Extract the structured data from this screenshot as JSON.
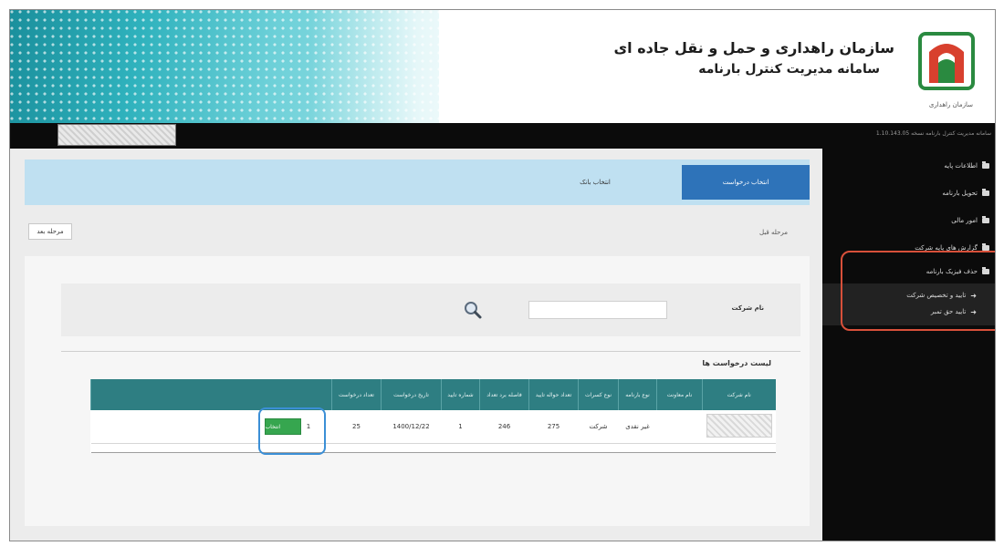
{
  "banner": {
    "title_line1": "سازمان راهداری و حمل و نقل جاده ای",
    "title_line2": "سامانه مدیریت کنترل بارنامه",
    "logo_caption": "سازمان راهداری",
    "logo_icon": "rmto-logo-icon"
  },
  "sidebar": {
    "version_text": "سامانه مدیریت کنترل بارنامه نسخه 1.10.143.05",
    "items": [
      {
        "label": "اطلاعات پایه",
        "icon": "folder-icon"
      },
      {
        "label": "تحویل بارنامه",
        "icon": "folder-icon"
      },
      {
        "label": "امور مالی",
        "icon": "folder-icon"
      },
      {
        "label": "گزارش های پایه شرکت",
        "icon": "folder-icon"
      },
      {
        "label": "حذف فیزیک بارنامه",
        "icon": "folder-icon"
      }
    ],
    "subitems": [
      {
        "label": "تایید و تخصیص شرکت",
        "icon": "sign-in-icon"
      },
      {
        "label": "تایید حق تمبر",
        "icon": "sign-in-icon"
      }
    ]
  },
  "tabs": {
    "active_label": "انتخاب درخواست",
    "bank_label": "انتخاب بانک"
  },
  "nav": {
    "prev_label": "مرحله قبل",
    "next_label": "مرحله بعد"
  },
  "search": {
    "company_label": "نام شرکت",
    "company_value": "",
    "icon": "search-icon"
  },
  "list": {
    "title": "لیست درخواست ها",
    "headers": [
      "نام شرکت",
      "نام معاونت",
      "نوع بارنامه",
      "نوع کسرات",
      "تعداد حواله تایید",
      "فاصله برد تعداد",
      "شماره تایید",
      "تاریخ درخواست",
      "تعداد درخواست",
      ""
    ],
    "rows": [
      {
        "company": "",
        "deputy": "",
        "waybill_type": "غیر نقدی",
        "deduction_type": "شرکت",
        "approved_count": "275",
        "range_count": "246",
        "approval_number": "1",
        "request_date": "1400/12/22",
        "request_count": "25",
        "action_label": "انتخاب",
        "action_index": "1"
      }
    ]
  },
  "colors": {
    "accent_blue": "#2e73b9",
    "table_header": "#2e7e82",
    "select_button": "#36a64f",
    "highlight_red": "#d8503a",
    "highlight_blue": "#3b8fd6"
  }
}
